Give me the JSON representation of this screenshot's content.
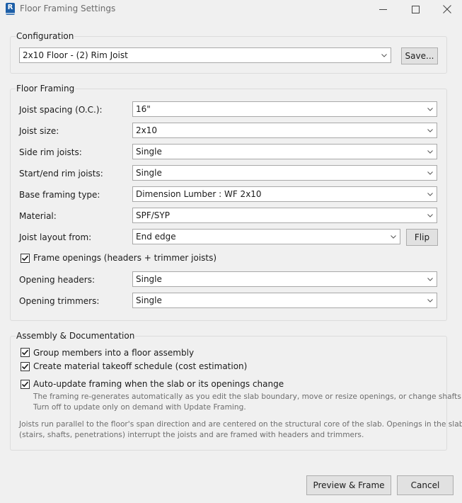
{
  "window": {
    "title": "Floor Framing Settings",
    "app_icon": "R"
  },
  "configuration": {
    "legend": "Configuration",
    "selected": "2x10 Floor - (2) Rim Joist",
    "save_label": "Save..."
  },
  "floor_framing": {
    "legend": "Floor Framing",
    "joist_spacing": {
      "label": "Joist spacing (O.C.):",
      "value": "16\""
    },
    "joist_size": {
      "label": "Joist size:",
      "value": "2x10"
    },
    "side_rim": {
      "label": "Side rim joists:",
      "value": "Single"
    },
    "start_end_rim": {
      "label": "Start/end rim joists:",
      "value": "Single"
    },
    "base_type": {
      "label": "Base framing type:",
      "value": "Dimension Lumber : WF 2x10"
    },
    "material": {
      "label": "Material:",
      "value": "SPF/SYP"
    },
    "layout_from": {
      "label": "Joist layout from:",
      "value": "End edge",
      "flip_label": "Flip"
    },
    "frame_openings": {
      "label": "Frame openings (headers + trimmer joists)",
      "checked": true
    },
    "opening_headers": {
      "label": "Opening headers:",
      "value": "Single"
    },
    "opening_trimmers": {
      "label": "Opening trimmers:",
      "value": "Single"
    }
  },
  "assembly": {
    "legend": "Assembly & Documentation",
    "group_members": {
      "label": "Group members into a floor assembly",
      "checked": true
    },
    "takeoff": {
      "label": "Create material takeoff schedule (cost estimation)",
      "checked": true
    },
    "auto_update": {
      "label": "Auto-update framing when the slab or its openings change",
      "checked": true
    },
    "auto_update_note_1": "The framing re-generates automatically as you edit the slab boundary, move or resize openings, or change shafts.",
    "auto_update_note_2": "Turn off to update only on demand with Update Framing.",
    "info_1": "Joists run parallel to the floor's span direction and are centered on the structural core of the slab. Openings in the slab",
    "info_2": "(stairs, shafts, penetrations) interrupt the joists and are framed with headers and trimmers."
  },
  "footer": {
    "preview_label": "Preview & Frame",
    "cancel_label": "Cancel"
  },
  "icons": {
    "minimize": "minimize-icon",
    "maximize": "maximize-icon",
    "close": "close-icon",
    "dropdown": "chevron-down-icon",
    "check": "checkmark-icon"
  }
}
